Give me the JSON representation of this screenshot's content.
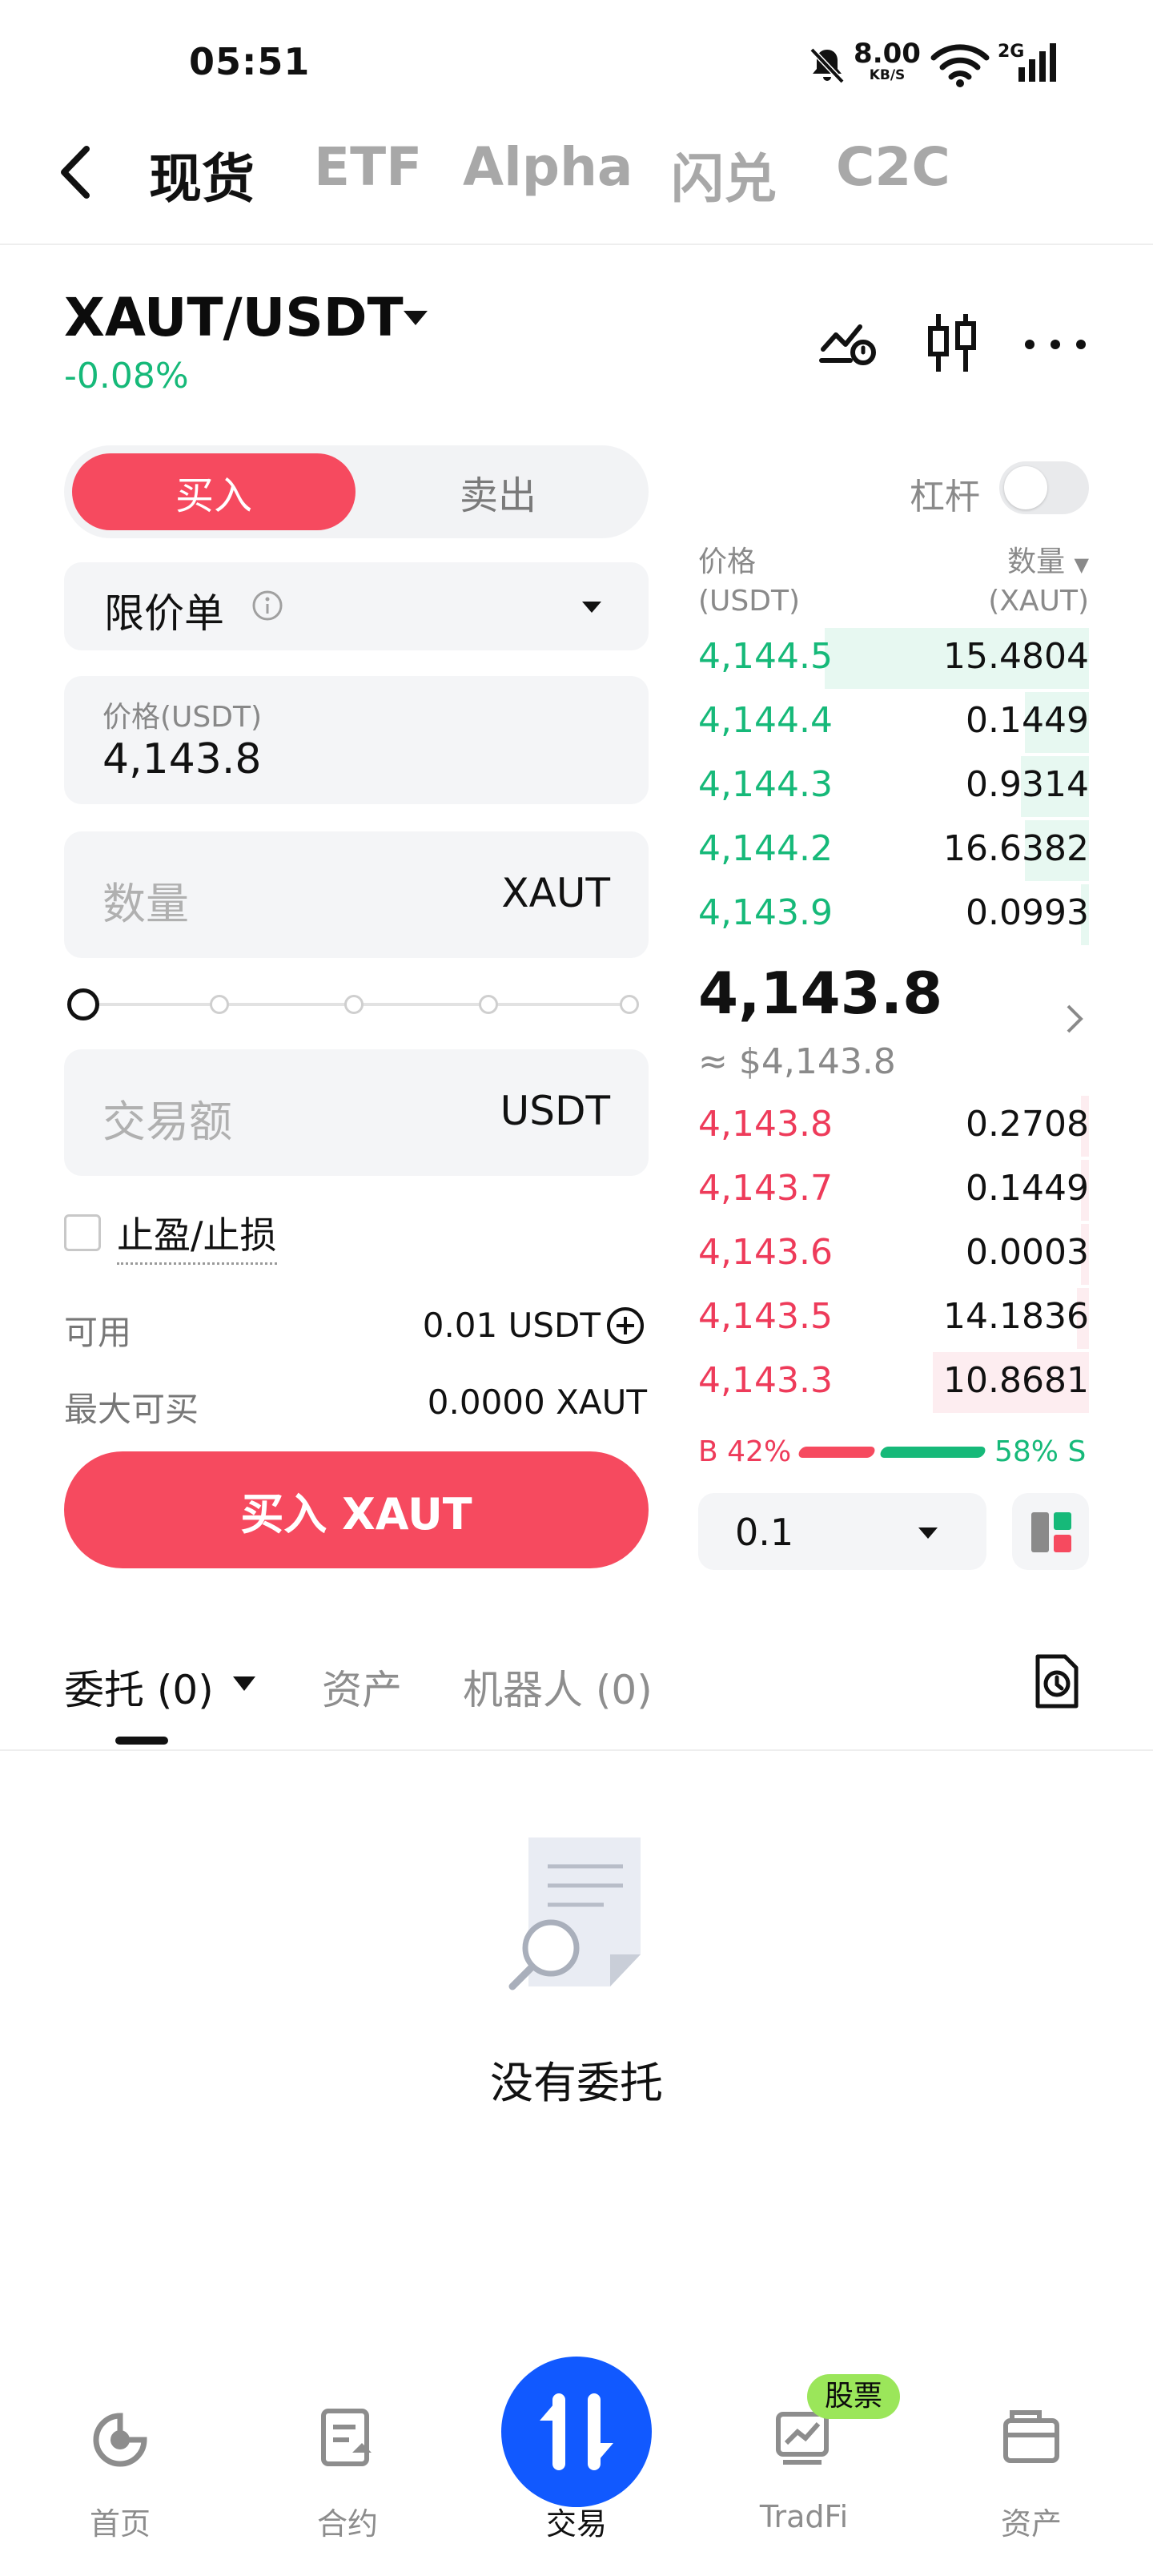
{
  "status_bar": {
    "time": "05:51",
    "speed_value": "8.00",
    "speed_unit": "KB/S",
    "network": "2G",
    "icons": [
      "bell-muted-icon",
      "wifi-icon",
      "signal-icon"
    ]
  },
  "top_nav": {
    "tabs": [
      {
        "label": "现货",
        "active": true
      },
      {
        "label": "ETF",
        "active": false
      },
      {
        "label": "Alpha",
        "active": false
      },
      {
        "label": "闪兑",
        "active": false
      },
      {
        "label": "C2C",
        "active": false
      }
    ]
  },
  "pair": {
    "symbol": "XAUT/USDT",
    "change": "-0.08%",
    "icons": [
      "price-alert-icon",
      "candlestick-icon",
      "more-icon"
    ]
  },
  "order_form": {
    "buy_tab": "买入",
    "sell_tab": "卖出",
    "leverage_label": "杠杆",
    "leverage_on": false,
    "order_type": "限价单",
    "price_label": "价格(USDT)",
    "price_value": "4,143.8",
    "quantity_placeholder": "数量",
    "quantity_unit": "XAUT",
    "slider_percent": 0,
    "total_placeholder": "交易额",
    "total_unit": "USDT",
    "tpsl_label": "止盈/止损",
    "available_label": "可用",
    "available_value": "0.01 USDT",
    "max_buy_label": "最大可买",
    "max_buy_value": "0.0000 XAUT",
    "submit_label": "买入 XAUT"
  },
  "order_book": {
    "price_header": "价格",
    "price_unit": "(USDT)",
    "qty_header": "数量",
    "qty_unit": "(XAUT)",
    "asks": [
      {
        "price": "4,144.5",
        "qty": "15.4804",
        "depth": 0.66
      },
      {
        "price": "4,144.4",
        "qty": "0.1449",
        "depth": 0.16
      },
      {
        "price": "4,144.3",
        "qty": "0.9314",
        "depth": 0.17
      },
      {
        "price": "4,144.2",
        "qty": "16.6382",
        "depth": 0.16
      },
      {
        "price": "4,143.9",
        "qty": "0.0993",
        "depth": 0.02
      }
    ],
    "last_price": "4,143.8",
    "last_price_usd": "≈ $4,143.8",
    "bids": [
      {
        "price": "4,143.8",
        "qty": "0.2708",
        "depth": 0.02
      },
      {
        "price": "4,143.7",
        "qty": "0.1449",
        "depth": 0.02
      },
      {
        "price": "4,143.6",
        "qty": "0.0003",
        "depth": 0.02
      },
      {
        "price": "4,143.5",
        "qty": "14.1836",
        "depth": 0.03
      },
      {
        "price": "4,143.3",
        "qty": "10.8681",
        "depth": 0.39
      }
    ],
    "buy_ratio_label": "B 42%",
    "sell_ratio_label": "58% S",
    "buy_ratio": 0.42,
    "precision": "0.1",
    "colors": {
      "buy": "#16b979",
      "sell": "#ee3b5a"
    }
  },
  "orders_section": {
    "tabs": [
      {
        "label": "委托 (0)",
        "active": true
      },
      {
        "label": "资产",
        "active": false
      },
      {
        "label": "机器人 (0)",
        "active": false
      }
    ],
    "empty_text": "没有委托"
  },
  "bottom_nav": {
    "items": [
      {
        "label": "首页",
        "icon": "home-icon",
        "active": false
      },
      {
        "label": "合约",
        "icon": "futures-icon",
        "active": false
      },
      {
        "label": "交易",
        "icon": "trade-icon",
        "active": true
      },
      {
        "label": "TradFi",
        "icon": "tradfi-icon",
        "active": false,
        "badge": "股票"
      },
      {
        "label": "资产",
        "icon": "wallet-icon",
        "active": false
      }
    ]
  }
}
